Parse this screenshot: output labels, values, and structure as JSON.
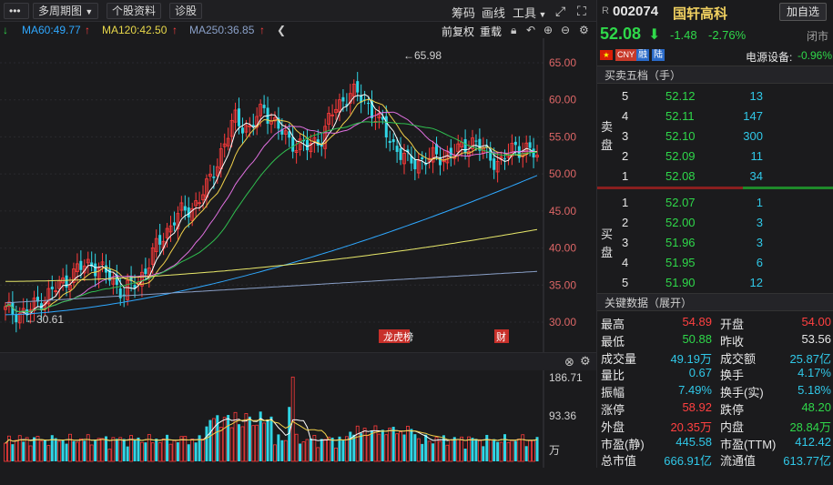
{
  "toolbar": {
    "more": "•••",
    "multi_period": "多周期图",
    "stock_info": "个股资料",
    "diagnose": "诊股",
    "chips": "筹码",
    "draw_line": "画线",
    "tools": "工具",
    "ma_row": {
      "ma60": "MA60:49.77",
      "ma120": "MA120:42.50",
      "ma250": "MA250:36.85",
      "up_arrow": "↑"
    },
    "adjust_prev": "前复权",
    "overlay": "重载"
  },
  "kchart": {
    "y_ticks": [
      "65.00",
      "60.00",
      "55.00",
      "50.00",
      "45.00",
      "40.00",
      "35.00",
      "30.00"
    ],
    "high_label": "←65.98",
    "low_label": "←30.61",
    "badge_lhb": "龙虎榜",
    "badge_fin": "财",
    "up_color": "#ff3b3b",
    "down_color": "#30d6e6"
  },
  "vchart": {
    "y_ticks": [
      "186.71",
      "93.36"
    ],
    "unit": "万"
  },
  "quote": {
    "market_tag": "R",
    "code": "002074",
    "name": "国轩高科",
    "add_watch": "加自选",
    "price": "52.08",
    "change": "-1.48",
    "change_pct": "-2.76%",
    "status": "闭市",
    "tags": [
      "CNY",
      "融",
      "陆"
    ],
    "sector_label": "电源设备:",
    "sector_change": "-0.96%"
  },
  "orderbook": {
    "title": "买卖五档（手）",
    "sell_label": "卖盘",
    "buy_label": "买盘",
    "sell": [
      {
        "level": "5",
        "price": "52.12",
        "vol": "13"
      },
      {
        "level": "4",
        "price": "52.11",
        "vol": "147"
      },
      {
        "level": "3",
        "price": "52.10",
        "vol": "300"
      },
      {
        "level": "2",
        "price": "52.09",
        "vol": "11"
      },
      {
        "level": "1",
        "price": "52.08",
        "vol": "34"
      }
    ],
    "buy": [
      {
        "level": "1",
        "price": "52.07",
        "vol": "1"
      },
      {
        "level": "2",
        "price": "52.00",
        "vol": "3"
      },
      {
        "level": "3",
        "price": "51.96",
        "vol": "3"
      },
      {
        "level": "4",
        "price": "51.95",
        "vol": "6"
      },
      {
        "level": "5",
        "price": "51.90",
        "vol": "12"
      }
    ]
  },
  "keydata": {
    "title": "关键数据（展开）",
    "rows": [
      {
        "l1": "最高",
        "v1": "54.89",
        "l2": "开盘",
        "v2": "54.00"
      },
      {
        "l1": "最低",
        "v1": "50.88",
        "l2": "昨收",
        "v2": "53.56"
      },
      {
        "l1": "成交量",
        "v1": "49.19万",
        "l2": "成交额",
        "v2": "25.87亿"
      },
      {
        "l1": "量比",
        "v1": "0.67",
        "l2": "换手",
        "v2": "4.17%"
      },
      {
        "l1": "振幅",
        "v1": "7.49%",
        "l2": "换手(实)",
        "v2": "5.18%"
      },
      {
        "l1": "涨停",
        "v1": "58.92",
        "l2": "跌停",
        "v2": "48.20"
      },
      {
        "l1": "外盘",
        "v1": "20.35万",
        "l2": "内盘",
        "v2": "28.84万"
      },
      {
        "l1": "市盈(静)",
        "v1": "445.58",
        "l2": "市盈(TTM)",
        "v2": "412.42"
      },
      {
        "l1": "总市值",
        "v1": "666.91亿",
        "l2": "流通值",
        "v2": "613.77亿"
      }
    ]
  }
}
